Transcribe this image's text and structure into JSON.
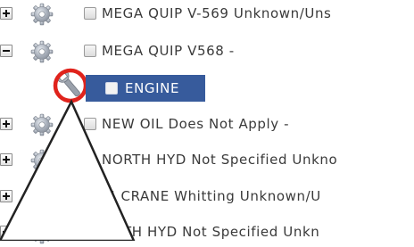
{
  "tree": {
    "items": [
      {
        "label": "MEGA QUIP V-569 Unknown/Uns",
        "expander": "plus"
      },
      {
        "label": "MEGA QUIP V568 -",
        "expander": "minus"
      },
      {
        "label": "ENGINE",
        "selected": true
      },
      {
        "label": "NEW OIL Does Not Apply -",
        "expander": "plus"
      },
      {
        "label": "NORTH HYD Not Specified Unkno",
        "expander": "plus"
      },
      {
        "label": "-4 CRANE Whitting Unknown/U",
        "expander": "plus"
      },
      {
        "label": "OUTH HYD Not Specified Unkn",
        "expander": "plus"
      }
    ]
  },
  "colors": {
    "selection_bg": "#375b9c",
    "highlight_ring": "#e0231c",
    "gear": "#a8aeb8",
    "text": "#3a3a3a"
  },
  "icons": {
    "expand": "plus-expander-icon",
    "collapse": "minus-expander-icon",
    "node": "gear-icon",
    "tool": "wrench-icon"
  }
}
